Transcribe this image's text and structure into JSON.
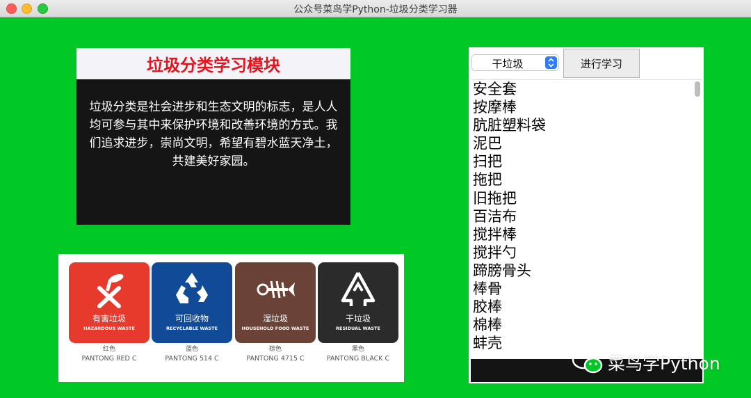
{
  "window": {
    "title": "公众号菜鸟学Python-垃圾分类学习器"
  },
  "module": {
    "title": "垃圾分类学习模块",
    "text": "垃圾分类是社会进步和生态文明的标志，是人人均可参与其中来保护环境和改善环境的方式。我们追求进步，崇尚文明，希望有碧水蓝天净土，共建美好家园。"
  },
  "bins": [
    {
      "cn": "有害垃圾",
      "en": "HAZARDOUS WASTE",
      "color_name": "红色",
      "pantone": "PANTONG RED C",
      "color": "#e63a2d",
      "icon": "hazardous-icon"
    },
    {
      "cn": "可回收物",
      "en": "RECYCLABLE WASTE",
      "color_name": "蓝色",
      "pantone": "PANTONG 514 C",
      "color": "#114b97",
      "icon": "recycle-icon"
    },
    {
      "cn": "湿垃圾",
      "en": "HOUSEHOLD FOOD WASTE",
      "color_name": "棕色",
      "pantone": "PANTONG 4715 C",
      "color": "#6b4236",
      "icon": "fishbone-icon"
    },
    {
      "cn": "干垃圾",
      "en": "RESIDUAL WASTE",
      "color_name": "黑色",
      "pantone": "PANTONG BLACK C",
      "color": "#2b2b2b",
      "icon": "residual-icon"
    }
  ],
  "controls": {
    "category_selected": "干垃圾",
    "learn_button": "进行学习"
  },
  "items": [
    "安全套",
    "按摩棒",
    "肮脏塑料袋",
    "泥巴",
    "扫把",
    "拖把",
    "旧拖把",
    "百洁布",
    "搅拌棒",
    "搅拌勺",
    "蹄膀骨头",
    "棒骨",
    "胶棒",
    "棉棒",
    "蚌壳"
  ],
  "watermark": {
    "text": "菜鸟学Python",
    "icon": "wechat-icon"
  }
}
